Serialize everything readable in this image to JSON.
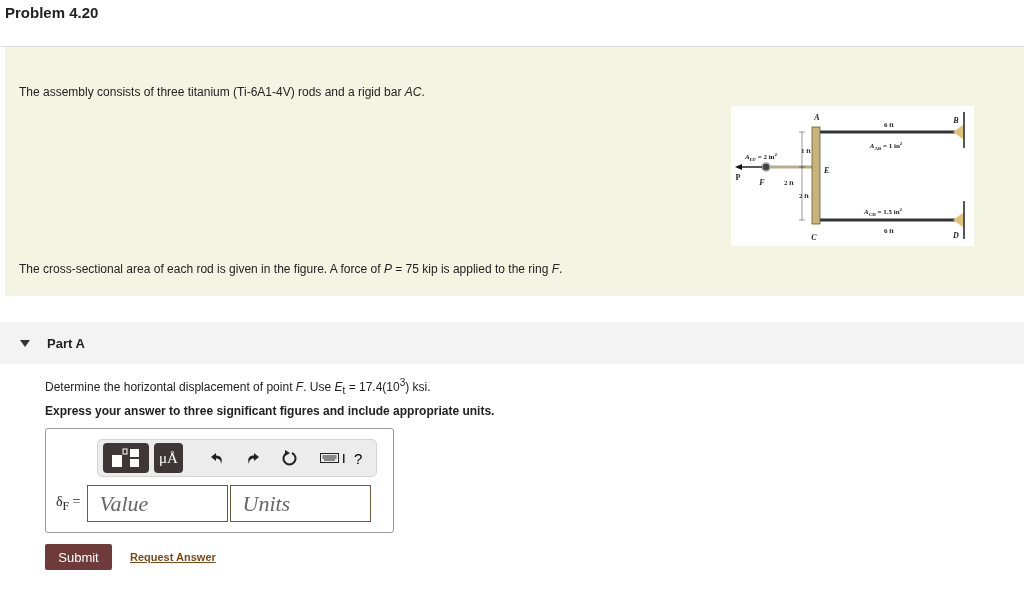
{
  "title": "Problem 4.20",
  "intro": {
    "text_1": "The assembly consists of three titanium (Ti-6A1-4V) rods and a rigid bar *AC*.",
    "text_2": "The cross-sectional area of each rod is given in the figure. A force of *P* = 75 kip is applied to the ring *F*.",
    "figure": {
      "labels": [
        {
          "kind": "point",
          "text": "A"
        },
        {
          "kind": "dim",
          "text": "6 ft"
        },
        {
          "kind": "point",
          "text": "B"
        },
        {
          "kind": "area",
          "text": "*A*$_{AB}$ = 1 in$^{2}$"
        },
        {
          "kind": "area",
          "text": "*A*$_{EF}$ = 2 in$^{2}$"
        },
        {
          "kind": "dim",
          "text": "1 ft"
        },
        {
          "kind": "point",
          "text": "E"
        },
        {
          "kind": "force",
          "text": "P"
        },
        {
          "kind": "point",
          "text": "F"
        },
        {
          "kind": "dim",
          "text": "2 ft"
        },
        {
          "kind": "dim",
          "text": "2 ft"
        },
        {
          "kind": "area",
          "text": "*A*$_{CD}$ = 1.5 in$^{2}$"
        },
        {
          "kind": "dim",
          "text": "6 ft"
        },
        {
          "kind": "point",
          "text": "C"
        },
        {
          "kind": "point",
          "text": "D"
        }
      ]
    }
  },
  "part": {
    "label": "Part A",
    "expanded": true,
    "question": "Determine the horizontal displacement of point *F*. Use *E*$_{t}$ = 17.4(10$^{3}$) ksi.",
    "instruction": "Express your answer to three significant figures and include appropriate units.",
    "answer": {
      "label": "δ$_{F}$ =",
      "toolbar": [
        {
          "kind": "template"
        },
        {
          "kind": "units",
          "text": "μÅ"
        },
        {
          "kind": "undo"
        },
        {
          "kind": "redo"
        },
        {
          "kind": "reset"
        },
        {
          "kind": "keyboard"
        },
        {
          "kind": "help",
          "text": "?"
        }
      ],
      "value_placeholder": "Value",
      "units_placeholder": "Units"
    },
    "buttons": {
      "submit": "Submit",
      "request": "Request Answer"
    }
  }
}
